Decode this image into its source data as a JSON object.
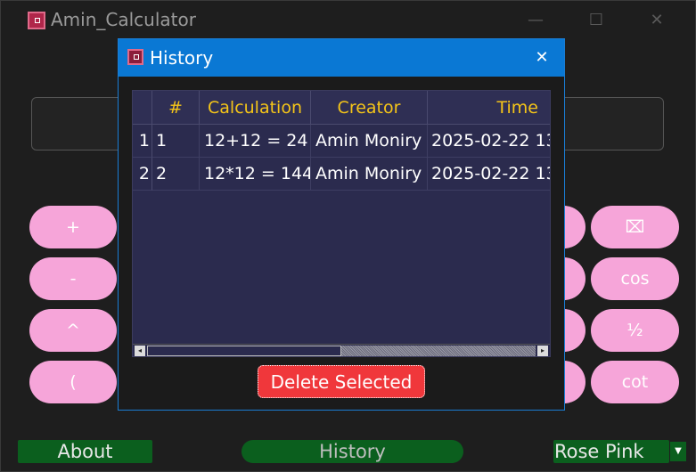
{
  "app": {
    "title": "Amin_Calculator"
  },
  "window_controls": {
    "minimize": "—",
    "maximize": "☐",
    "close": "✕"
  },
  "keys": {
    "left": [
      "+",
      "-",
      "^",
      "("
    ],
    "right": [
      "⌧",
      "cos",
      "½",
      "cot"
    ]
  },
  "bottom_bar": {
    "about_label": "About",
    "history_label": "History",
    "theme_value": "Rose Pink",
    "theme_arrow": "▼"
  },
  "history_dialog": {
    "title": "History",
    "close": "✕",
    "columns": [
      "#",
      "Calculation",
      "Creator",
      "Time"
    ],
    "rows": [
      {
        "index": "1",
        "num": "1",
        "calculation": "12+12 = 24",
        "creator": "Amin Moniry",
        "time": "2025-02-22 13"
      },
      {
        "index": "2",
        "num": "2",
        "calculation": "12*12 = 144",
        "creator": "Amin Moniry",
        "time": "2025-02-22 13"
      }
    ],
    "scroll_left": "◂",
    "scroll_right": "▸",
    "delete_label": "Delete Selected"
  },
  "colors": {
    "key_pink": "#f6a5d9",
    "header_gold": "#f5c518",
    "dialog_blue": "#0a78d4",
    "delete_red": "#f0373b",
    "bottom_green": "#0b5f1e"
  }
}
